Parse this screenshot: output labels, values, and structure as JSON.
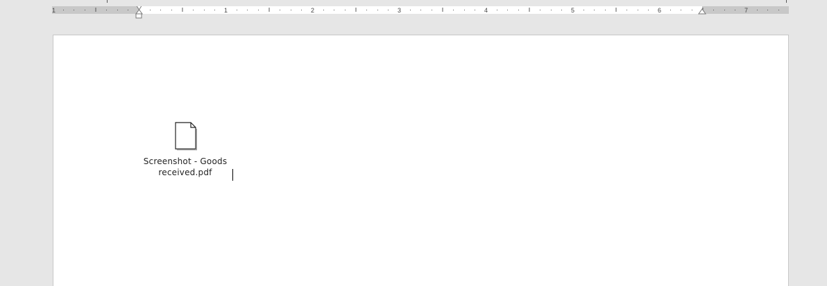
{
  "document": {
    "ruler": {
      "numbers": [
        "1",
        "1",
        "2",
        "3",
        "4",
        "5",
        "6",
        "7"
      ]
    },
    "attachment": {
      "icon": "document-file-icon",
      "name_line1": "Screenshot - Goods",
      "name_line2": "received.pdf"
    }
  }
}
